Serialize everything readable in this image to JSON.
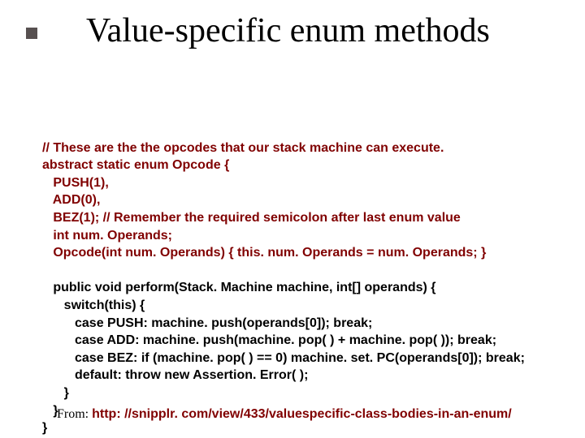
{
  "title": "Value-specific enum methods",
  "code": {
    "l1": "// These are the the opcodes that our stack machine can execute.",
    "l2": "abstract static enum Opcode {",
    "l3": "   PUSH(1),",
    "l4": "   ADD(0),",
    "l5": "   BEZ(1); // Remember the required semicolon after last enum value",
    "l6": "   int num. Operands;",
    "l7": "   Opcode(int num. Operands) { this. num. Operands = num. Operands; }",
    "l8": "",
    "l9": "   public void perform(Stack. Machine machine, int[] operands) {",
    "l10": "      switch(this) {",
    "l11": "         case PUSH: machine. push(operands[0]); break;",
    "l12": "         case ADD: machine. push(machine. pop( ) + machine. pop( )); break;",
    "l13": "         case BEZ: if (machine. pop( ) == 0) machine. set. PC(operands[0]); break;",
    "l14": "         default: throw new Assertion. Error( );",
    "l15": "      }",
    "l16": "   }",
    "l17": "}"
  },
  "footer": {
    "from": "From: ",
    "url": "http: //snipplr. com/view/433/valuespecific-class-bodies-in-an-enum/"
  }
}
